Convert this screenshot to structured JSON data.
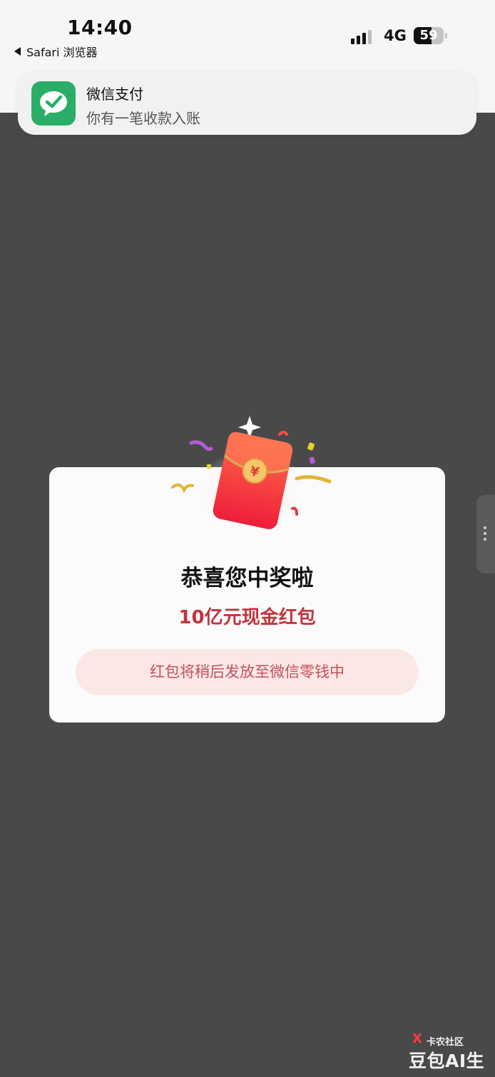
{
  "status_bar": {
    "time": "14:40",
    "back_label": "Safari 浏览器",
    "network": "4G",
    "battery_level": "59",
    "battery_fraction": 0.59
  },
  "notification": {
    "app_name": "微信支付",
    "message": "你有一笔收款入账",
    "icon": "wechat-pay-icon"
  },
  "dialog": {
    "title": "恭喜您中奖啦",
    "amount": "10亿元现金红包",
    "note": "红包将稍后发放至微信零钱中",
    "coin_symbol": "¥"
  },
  "watermark": {
    "line1_mark": "X",
    "line1": "卡农社区",
    "line2": "豆包AI生成"
  },
  "colors": {
    "overlay": "#494949",
    "wechat_green": "#2aae67",
    "accent_red": "#c3343f",
    "pill_background": "#fbe7e6"
  }
}
